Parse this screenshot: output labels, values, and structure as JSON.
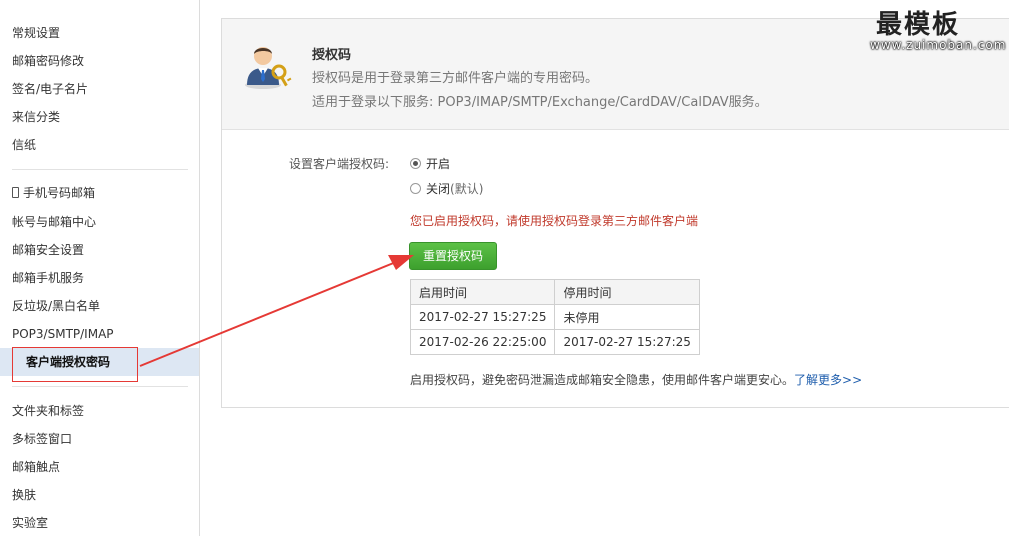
{
  "sidebar": {
    "groups": [
      {
        "items": [
          {
            "label": "常规设置"
          },
          {
            "label": "邮箱密码修改"
          },
          {
            "label": "签名/电子名片"
          },
          {
            "label": "来信分类"
          },
          {
            "label": "信纸"
          }
        ]
      },
      {
        "items": [
          {
            "label": "手机号码邮箱",
            "icon": "mobile-phone-icon"
          },
          {
            "label": "帐号与邮箱中心"
          },
          {
            "label": "邮箱安全设置"
          },
          {
            "label": "邮箱手机服务"
          },
          {
            "label": "反垃圾/黑白名单"
          },
          {
            "label": "POP3/SMTP/IMAP"
          },
          {
            "label": "客户端授权密码",
            "active": true
          }
        ]
      },
      {
        "items": [
          {
            "label": "文件夹和标签"
          },
          {
            "label": "多标签窗口"
          },
          {
            "label": "邮箱触点"
          },
          {
            "label": "换肤"
          },
          {
            "label": "实验室"
          }
        ]
      }
    ]
  },
  "panel": {
    "icon": "user-key-icon",
    "title": "授权码",
    "description": "授权码是用于登录第三方邮件客户端的专用密码。",
    "services": "适用于登录以下服务: POP3/IMAP/SMTP/Exchange/CardDAV/CalDAV服务。",
    "setting_label": "设置客户端授权码:",
    "options": [
      {
        "label": "开启",
        "checked": true
      },
      {
        "label": "关闭",
        "suffix": "(默认)",
        "checked": false
      }
    ],
    "enabled_notice": "您已启用授权码，请使用授权码登录第三方邮件客户端",
    "reset_button": "重置授权码",
    "table": {
      "headers": [
        "启用时间",
        "停用时间"
      ],
      "rows": [
        [
          "2017-02-27 15:27:25",
          "未停用"
        ],
        [
          "2017-02-26 22:25:00",
          "2017-02-27 15:27:25"
        ]
      ]
    },
    "footer_note": "启用授权码，避免密码泄漏造成邮箱安全隐患，使用邮件客户端更安心。",
    "learn_more": "了解更多>>"
  },
  "watermark": {
    "title": "最模板",
    "url": "www.zuimoban.com"
  },
  "colors": {
    "accent_green": "#4cb43a",
    "notice_red": "#c0392b",
    "link_blue": "#1e5dac",
    "annotation_red": "#e53935",
    "active_row": "#dde7f3"
  }
}
